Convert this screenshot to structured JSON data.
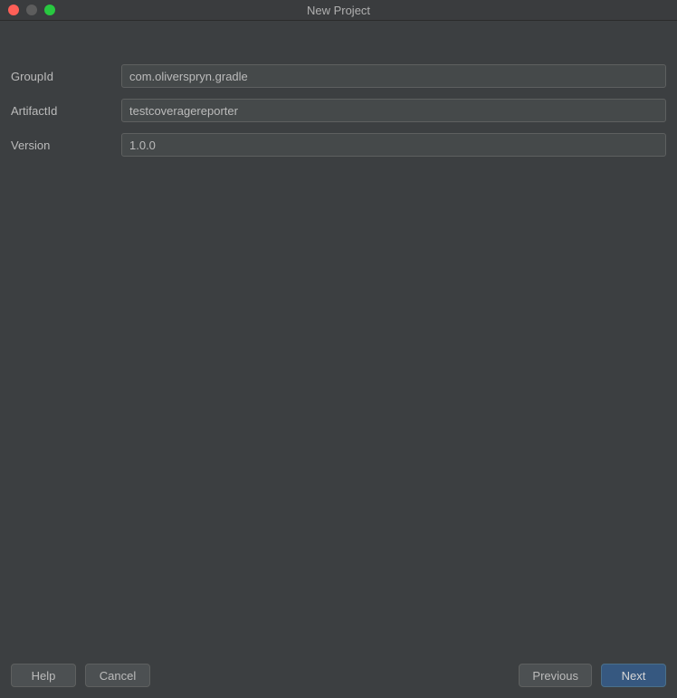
{
  "window": {
    "title": "New Project"
  },
  "form": {
    "groupId": {
      "label": "GroupId",
      "value": "com.oliverspryn.gradle"
    },
    "artifactId": {
      "label": "ArtifactId",
      "value": "testcoveragereporter"
    },
    "version": {
      "label": "Version",
      "value": "1.0.0"
    }
  },
  "buttons": {
    "help": "Help",
    "cancel": "Cancel",
    "previous": "Previous",
    "next": "Next"
  }
}
